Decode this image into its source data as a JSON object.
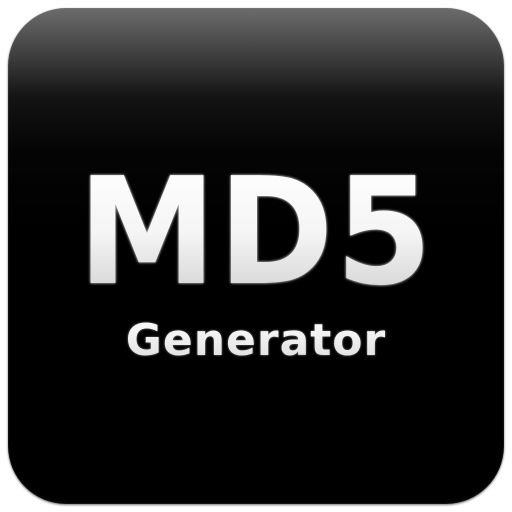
{
  "icon": {
    "title": "MD5",
    "subtitle": "Generator",
    "colors": {
      "background": "#000000",
      "gloss": "#5b5b5b",
      "text": "#f1f1f1"
    }
  }
}
